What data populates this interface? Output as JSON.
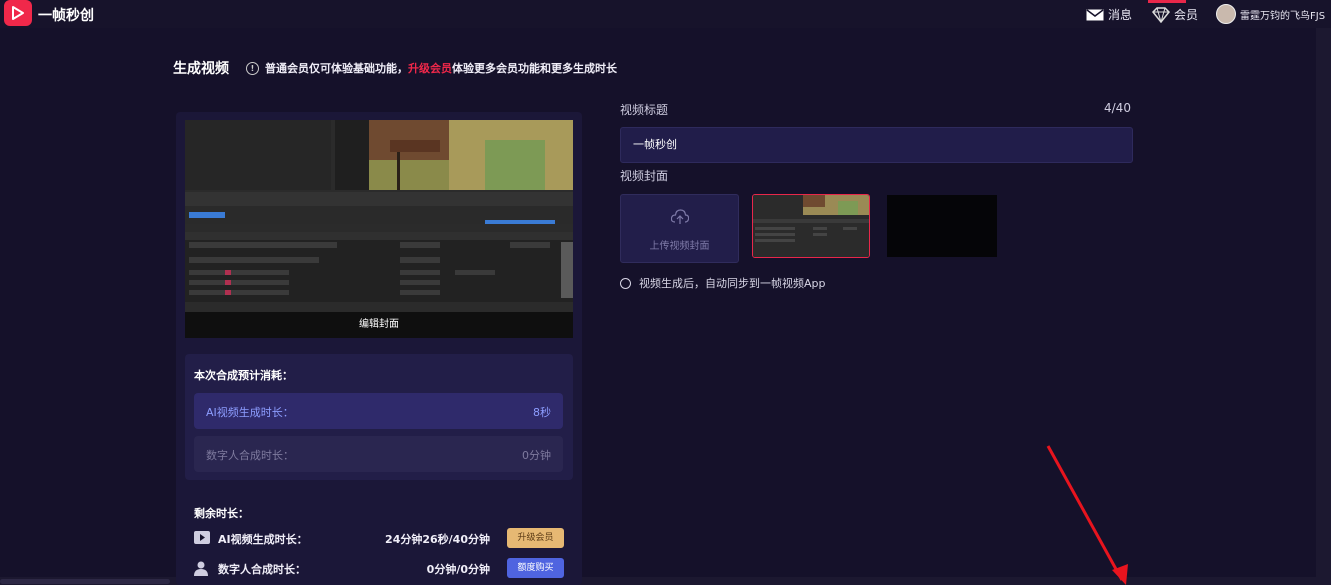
{
  "app": {
    "brand": "一帧秒创"
  },
  "nav": {
    "messages": "消息",
    "member": "会员",
    "user_name": "雷霆万钧的飞鸟FJS"
  },
  "page": {
    "title": "生成视频",
    "notice_pre": "普通会员仅可体验基础功能，",
    "notice_highlight": "升级会员",
    "notice_post": "体验更多会员功能和更多生成时长"
  },
  "preview": {
    "edit_cover_label": "编辑封面"
  },
  "cost": {
    "title": "本次合成预计消耗：",
    "ai_label": "AI视频生成时长：",
    "ai_value": "8秒",
    "digital_label": "数字人合成时长：",
    "digital_value": "0分钟"
  },
  "remaining": {
    "title": "剩余时长：",
    "ai_label": "AI视频生成时长：",
    "ai_value": "24分钟26秒/40分钟",
    "upgrade_button": "升级会员",
    "digital_label": "数字人合成时长：",
    "digital_value": "0分钟/0分钟",
    "buy_button": "额度购买"
  },
  "form": {
    "title_label": "视频标题",
    "title_counter": "4/40",
    "title_value": "一帧秒创",
    "cover_label": "视频封面",
    "upload_cover": "上传视频封面",
    "sync_label": "视频生成后，自动同步到一帧视频App"
  },
  "colors": {
    "accent": "#e8274a",
    "background": "#15112a",
    "upgrade": "#e6b873",
    "buy": "#4f64e0"
  }
}
